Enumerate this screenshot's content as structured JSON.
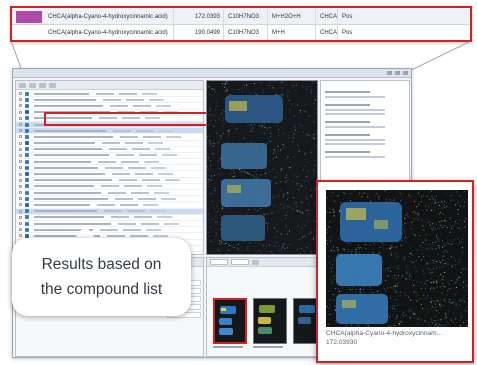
{
  "top_zoom": {
    "rows": [
      {
        "name": "CHCA(alpha-Cyano-4-hydroxycinnamic acid)",
        "mz": "172.0393",
        "formula": "C10H7NO3",
        "adduct": "M+H2O+H",
        "abbr": "CHCA",
        "extra": "Pos",
        "swatch": "#b04aa8",
        "selected": true
      },
      {
        "name": "CHCA(alpha-Cyano-4-hydroxycinnamic acid)",
        "mz": "190.0499",
        "formula": "C10H7NO3",
        "adduct": "M+H",
        "abbr": "CHCA",
        "extra": "Pos",
        "swatch": "",
        "selected": false
      }
    ]
  },
  "zoom_panel": {
    "caption_name": "CHCA(alpha-Cyano-4-hydroxycinnam...",
    "caption_mz": "172.03930"
  },
  "bubble": {
    "line1": "Results based on",
    "line2": "the compound list"
  },
  "colors": {
    "highlight": "#d42020",
    "selection": "#c9dcf3",
    "accent_tab": "#3d79c0",
    "tissue_blue": "#2f78c8",
    "tissue_yellow": "#e4d23a"
  }
}
